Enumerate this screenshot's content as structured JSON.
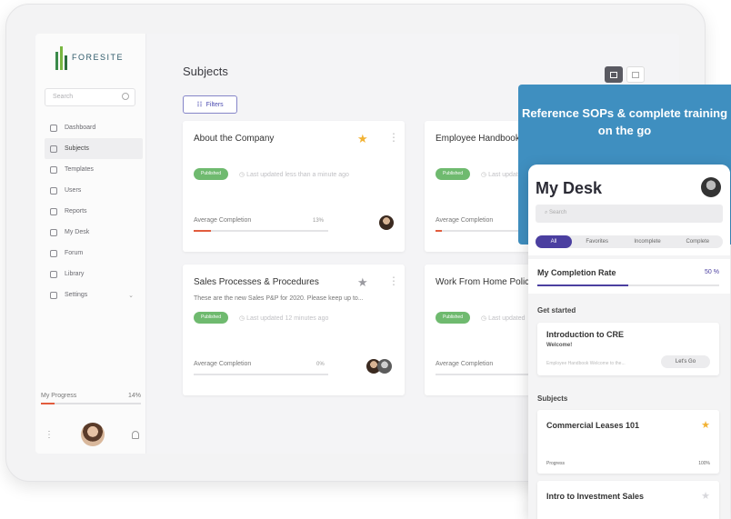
{
  "brand": {
    "name": "FORESITE"
  },
  "sidebar": {
    "search_placeholder": "Search",
    "items": [
      {
        "label": "Dashboard",
        "icon": "home-icon"
      },
      {
        "label": "Subjects",
        "icon": "document-icon",
        "active": true
      },
      {
        "label": "Templates",
        "icon": "template-icon"
      },
      {
        "label": "Users",
        "icon": "users-icon"
      },
      {
        "label": "Reports",
        "icon": "report-icon"
      },
      {
        "label": "My Desk",
        "icon": "desk-icon"
      },
      {
        "label": "Forum",
        "icon": "forum-icon"
      },
      {
        "label": "Library",
        "icon": "library-icon"
      },
      {
        "label": "Settings",
        "icon": "gear-icon"
      }
    ],
    "progress_label": "My Progress",
    "progress_value": "14%",
    "progress_fraction": 0.14
  },
  "main": {
    "title": "Subjects",
    "filters_label": "Filters",
    "cards": [
      {
        "title": "About the Company",
        "description": "",
        "status": "Published",
        "updated": "Last updated less than a minute ago",
        "avg_label": "Average Completion",
        "avg_value": "13%",
        "avg_fraction": 0.13,
        "starred": true
      },
      {
        "title": "Employee Handbook",
        "description": "",
        "status": "Published",
        "updated": "Last updated",
        "avg_label": "Average Completion",
        "avg_value": "",
        "avg_fraction": 0.05,
        "starred": false
      },
      {
        "title": "Sales Processes & Procedures",
        "description": "These are the new Sales P&P for 2020. Please keep up to...",
        "status": "Published",
        "updated": "Last updated 12 minutes ago",
        "avg_label": "Average Completion",
        "avg_value": "0%",
        "avg_fraction": 0,
        "starred": false
      },
      {
        "title": "Work From Home Polic",
        "description": "",
        "status": "Published",
        "updated": "Last updated",
        "avg_label": "Average Completion",
        "avg_value": "",
        "avg_fraction": 0,
        "starred": false
      }
    ]
  },
  "promo": {
    "text": "Reference SOPs & complete training on the go"
  },
  "mobile": {
    "title": "My Desk",
    "search_placeholder": "Search",
    "tabs": [
      "All",
      "Favorites",
      "Incomplete",
      "Complete"
    ],
    "completion_label": "My Completion Rate",
    "completion_value": "50 %",
    "completion_fraction": 0.5,
    "get_started_label": "Get started",
    "intro_card": {
      "title": "Introduction to CRE",
      "subtitle": "Welcome!",
      "meta": "Employee Handbook Welcome to the...",
      "button": "Let's Go"
    },
    "subjects_label": "Subjects",
    "subject_cards": [
      {
        "title": "Commercial Leases 101",
        "progress_label": "Progress",
        "progress_value": "100%",
        "starred": true
      },
      {
        "title": "Intro to Investment Sales",
        "starred": false
      }
    ]
  },
  "colors": {
    "accent": "#4b3fa0",
    "published": "#6fba6f",
    "progress": "#e25c3d",
    "promo": "#3f8fc0",
    "star": "#f2b233"
  }
}
